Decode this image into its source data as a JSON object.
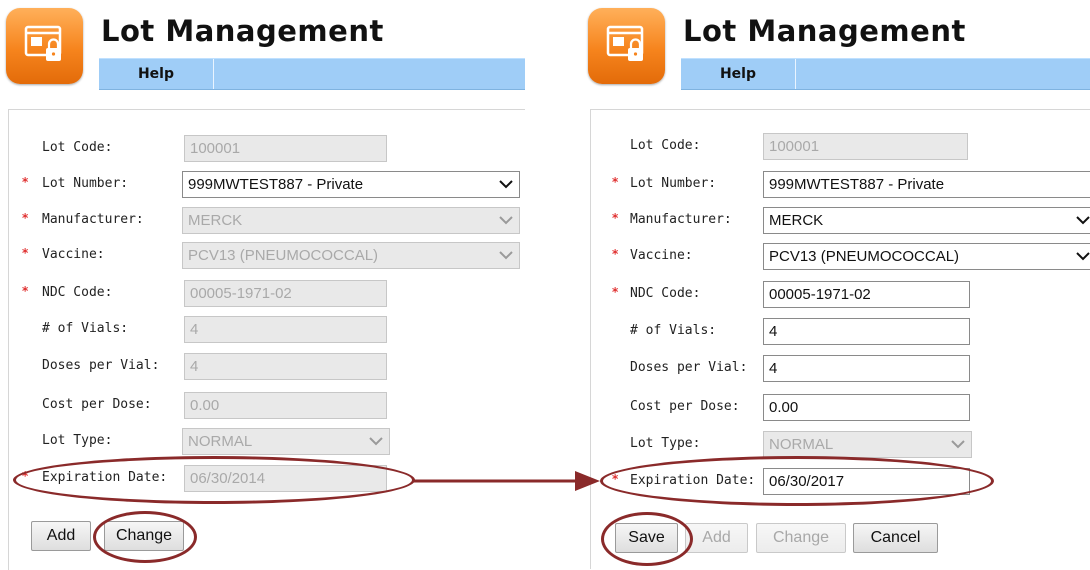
{
  "left": {
    "title": "Lot Management",
    "help": "Help",
    "fields": {
      "lot_code": {
        "label": "Lot Code:",
        "value": "100001"
      },
      "lot_number": {
        "label": "Lot Number:",
        "value": "999MWTEST887 - Private"
      },
      "manufacturer": {
        "label": "Manufacturer:",
        "value": "MERCK"
      },
      "vaccine": {
        "label": "Vaccine:",
        "value": "PCV13 (PNEUMOCOCCAL)"
      },
      "ndc_code": {
        "label": "NDC Code:",
        "value": "00005-1971-02"
      },
      "vials": {
        "label": "# of Vials:",
        "value": "4"
      },
      "doses": {
        "label": "Doses per Vial:",
        "value": "4"
      },
      "cost": {
        "label": "Cost per Dose:",
        "value": "0.00"
      },
      "lot_type": {
        "label": "Lot Type:",
        "value": "NORMAL"
      },
      "expiration": {
        "label": "Expiration Date:",
        "value": "06/30/2014"
      }
    },
    "buttons": {
      "add": "Add",
      "change": "Change"
    }
  },
  "right": {
    "title": "Lot Management",
    "help": "Help",
    "fields": {
      "lot_code": {
        "label": "Lot Code:",
        "value": "100001"
      },
      "lot_number": {
        "label": "Lot Number:",
        "value": "999MWTEST887 - Private"
      },
      "manufacturer": {
        "label": "Manufacturer:",
        "value": "MERCK"
      },
      "vaccine": {
        "label": "Vaccine:",
        "value": "PCV13 (PNEUMOCOCCAL)"
      },
      "ndc_code": {
        "label": "NDC Code:",
        "value": "00005-1971-02"
      },
      "vials": {
        "label": "# of Vials:",
        "value": "4"
      },
      "doses": {
        "label": "Doses per Vial:",
        "value": "4"
      },
      "cost": {
        "label": "Cost per Dose:",
        "value": "0.00"
      },
      "lot_type": {
        "label": "Lot Type:",
        "value": "NORMAL"
      },
      "expiration": {
        "label": "Expiration Date:",
        "value": "06/30/2017"
      }
    },
    "buttons": {
      "save": "Save",
      "add": "Add",
      "change": "Change",
      "cancel": "Cancel"
    }
  },
  "required_marker": "*",
  "colors": {
    "accent_orange": "#f6841d",
    "nav_blue": "#9fcdf7",
    "annotation_red": "#8a2a2a",
    "required_red": "#e03030"
  },
  "icons": {
    "app": "window-lock-icon",
    "dropdown": "chevron-down-icon"
  }
}
